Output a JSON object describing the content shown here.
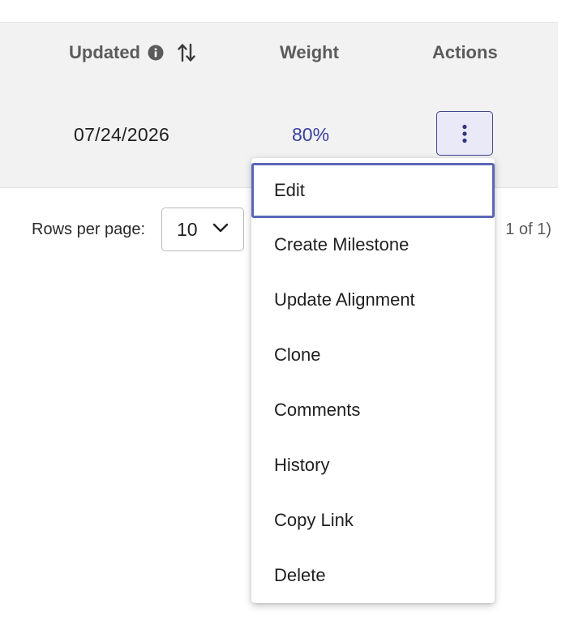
{
  "table": {
    "headers": {
      "updated": "Updated",
      "weight": "Weight",
      "actions": "Actions"
    },
    "row": {
      "updated": "07/24/2026",
      "weight": "80%"
    }
  },
  "pagination": {
    "rows_per_page_label": "Rows per page:",
    "rows_per_page_value": "10",
    "page_info": "1 of 1)"
  },
  "actions_menu": {
    "items": [
      {
        "label": "Edit"
      },
      {
        "label": "Create Milestone"
      },
      {
        "label": "Update Alignment"
      },
      {
        "label": "Clone"
      },
      {
        "label": "Comments"
      },
      {
        "label": "History"
      },
      {
        "label": "Copy Link"
      },
      {
        "label": "Delete"
      }
    ]
  },
  "colors": {
    "accent": "#3a3f9e",
    "focus": "#5c66b8",
    "header_bg": "#f2f2f2"
  },
  "icons": {
    "info": "info-icon",
    "sort": "sort-icon",
    "more": "more-vertical-icon",
    "chevron": "chevron-down-icon"
  }
}
